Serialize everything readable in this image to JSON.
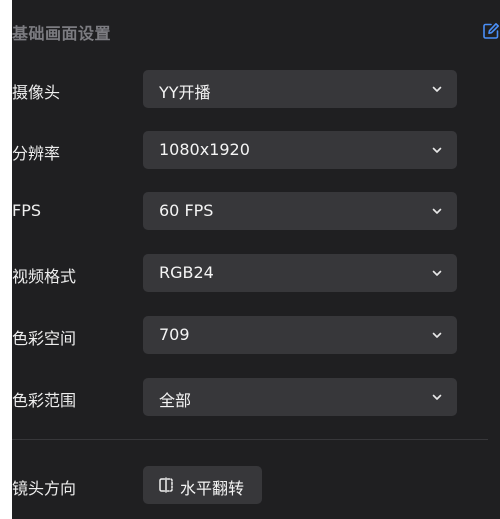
{
  "header": {
    "title": "基础画面设置",
    "edit_icon": "edit-icon",
    "accent_color": "#4a8ff7"
  },
  "settings": [
    {
      "label": "摄像头",
      "value": "YY开播"
    },
    {
      "label": "分辨率",
      "value": "1080x1920"
    },
    {
      "label": "FPS",
      "value": "60 FPS"
    },
    {
      "label": "视频格式",
      "value": "RGB24"
    },
    {
      "label": "色彩空间",
      "value": "709"
    },
    {
      "label": "色彩范围",
      "value": "全部"
    }
  ],
  "mirror": {
    "label": "镜头方向",
    "button_label": "水平翻转",
    "button_icon": "flip-horizontal-icon"
  }
}
